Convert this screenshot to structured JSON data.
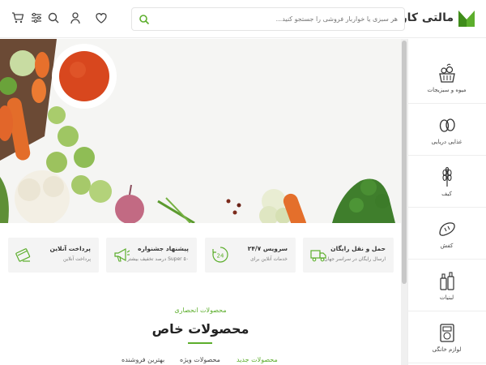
{
  "header": {
    "logo_text": "مالتی کارت",
    "search_placeholder": "هر سبزی یا خواربار فروشی را جستجو کنید...",
    "icons": [
      "cart-icon",
      "filter-icon",
      "search-icon",
      "user-icon",
      "heart-icon"
    ],
    "accent_color": "#5cae2c"
  },
  "sidebar": {
    "items": [
      {
        "label": "میوه و سبزیجات",
        "icon": "vegetables-basket-icon"
      },
      {
        "label": "غذایی دریایی",
        "icon": "eggs-icon"
      },
      {
        "label": "کیف",
        "icon": "wheat-icon"
      },
      {
        "label": "کفش",
        "icon": "bread-icon"
      },
      {
        "label": "لبنیات",
        "icon": "bottles-icon"
      },
      {
        "label": "لوازم خانگی",
        "icon": "appliance-icon"
      }
    ]
  },
  "features": [
    {
      "title": "حمل و نقل رایگان",
      "subtitle": "ارسال رایگان در سراسر جهان",
      "icon": "truck-icon"
    },
    {
      "title": "سرویس ۲۴/۷",
      "subtitle": "خدمات آنلاین برای",
      "icon": "support-24-icon"
    },
    {
      "title": "پیشنهاد جشنواره",
      "subtitle": "Super ۵۰ درصد تخفیف بیشتر",
      "icon": "megaphone-icon"
    },
    {
      "title": "پرداخت آنلاین",
      "subtitle": "پرداخت آنلاین",
      "icon": "card-payment-icon"
    }
  ],
  "section": {
    "subtitle": "محصولات انحصاری",
    "title": "محصولات خاص",
    "tabs": [
      {
        "label": "محصولات جدید",
        "active": true
      },
      {
        "label": "محصولات ویژه",
        "active": false
      },
      {
        "label": "بهترین فروشنده",
        "active": false
      }
    ]
  }
}
